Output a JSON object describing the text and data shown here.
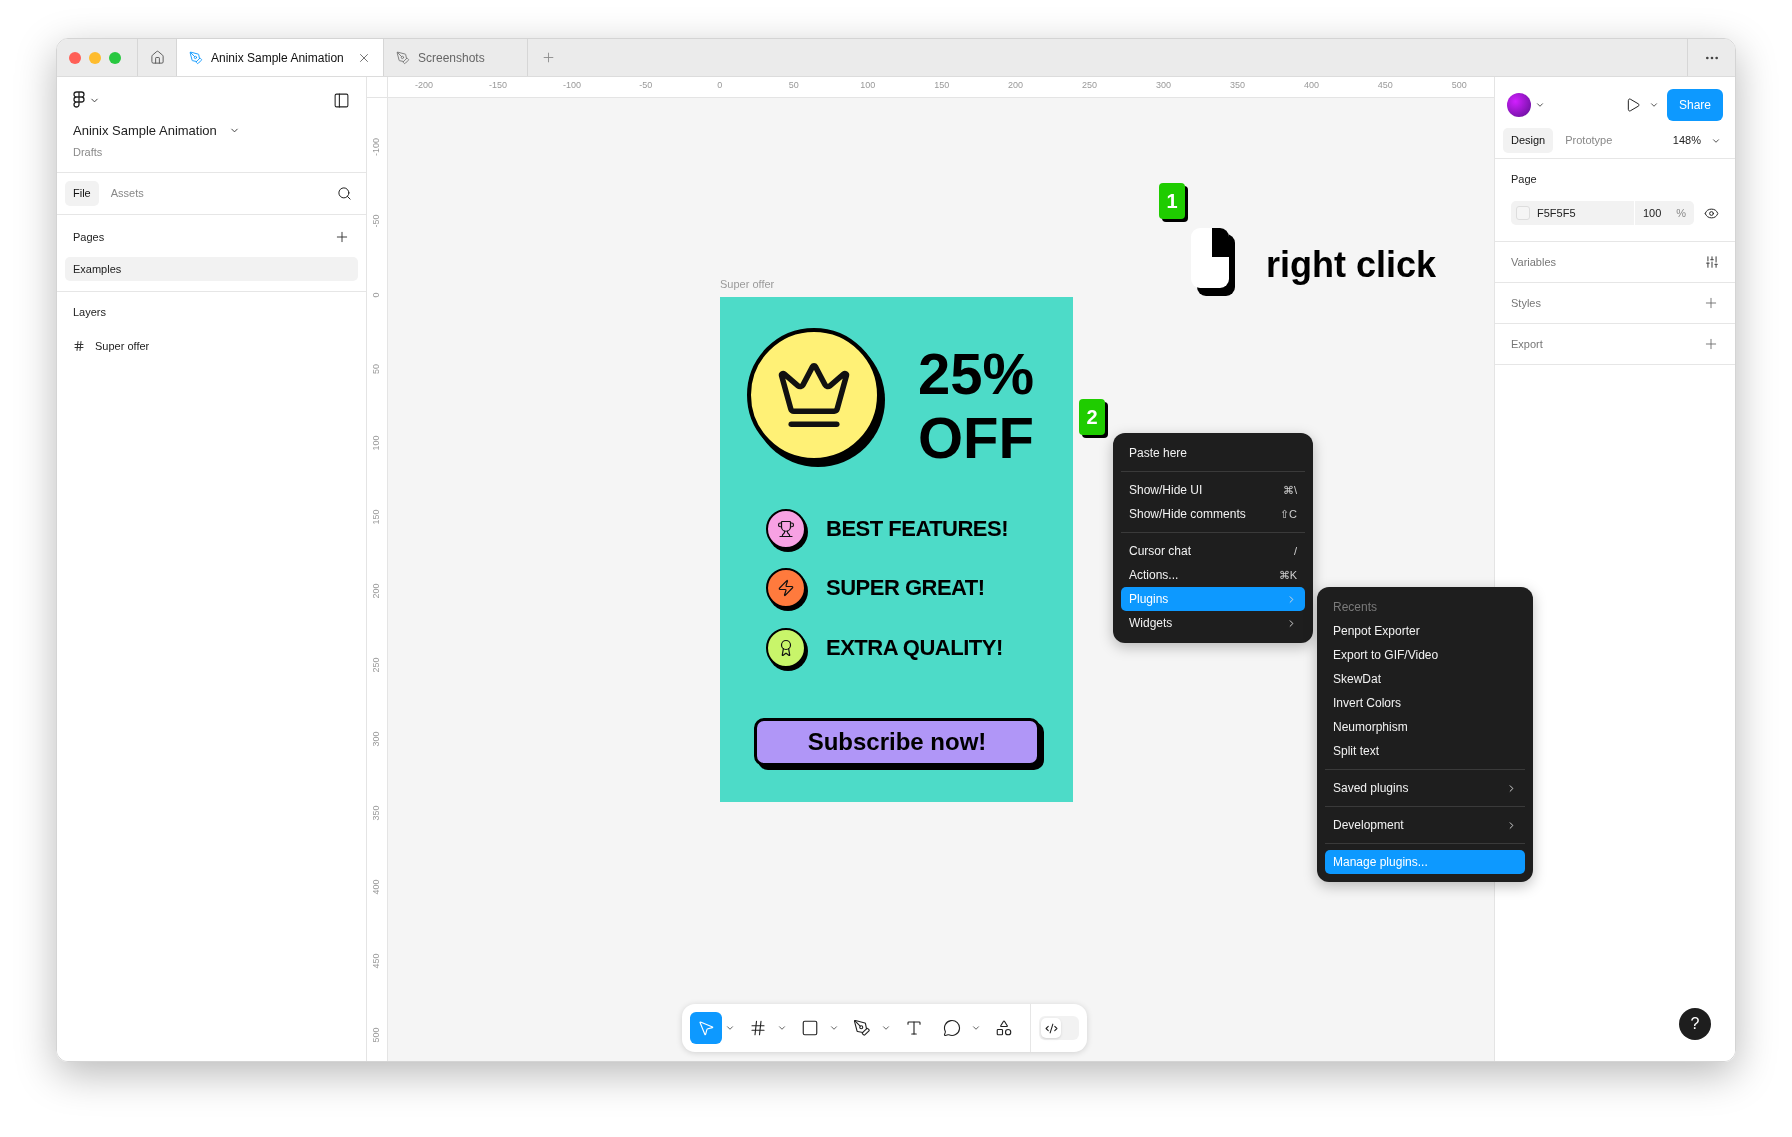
{
  "window": {
    "tabs": [
      {
        "label": "Aninix Sample Animation",
        "selected": true
      },
      {
        "label": "Screenshots",
        "selected": false
      }
    ]
  },
  "sidebar": {
    "file_name": "Aninix Sample Animation",
    "location": "Drafts",
    "tabs": [
      {
        "label": "File",
        "selected": true
      },
      {
        "label": "Assets",
        "selected": false
      }
    ],
    "pages_heading": "Pages",
    "pages": [
      {
        "label": "Examples",
        "selected": true
      }
    ],
    "layers_heading": "Layers",
    "layers": [
      {
        "label": "Super offer"
      }
    ]
  },
  "rulers": {
    "horizontal": [
      "-200",
      "-150",
      "-100",
      "-50",
      "0",
      "50",
      "100",
      "150",
      "200",
      "250",
      "300",
      "350",
      "400",
      "450",
      "500"
    ],
    "vertical": [
      "-100",
      "-50",
      "0",
      "50",
      "100",
      "150",
      "200",
      "250",
      "300",
      "350",
      "400",
      "450",
      "500"
    ]
  },
  "canvas": {
    "frame_label": "Super offer",
    "discount": "25%",
    "discount_word": "OFF",
    "features": [
      {
        "label": "BEST FEATURES!",
        "color": "#f7a1e3",
        "kind": "trophy"
      },
      {
        "label": "SUPER GREAT!",
        "color": "#ff7a3d",
        "kind": "bolt"
      },
      {
        "label": "EXTRA QUALITY!",
        "color": "#c8f56a",
        "kind": "award"
      }
    ],
    "cta": "Subscribe now!",
    "steps": [
      {
        "number": "1"
      },
      {
        "number": "2"
      }
    ],
    "hint": "right click"
  },
  "context_menu": {
    "groups": [
      [
        {
          "label": "Paste here",
          "submenu": false,
          "selected": false
        }
      ],
      [
        {
          "label": "Show/Hide UI",
          "shortcut": "⌘\\",
          "submenu": false,
          "selected": false
        },
        {
          "label": "Show/Hide comments",
          "shortcut": "⇧C",
          "submenu": false,
          "selected": false
        }
      ],
      [
        {
          "label": "Cursor chat",
          "shortcut": "/",
          "submenu": false,
          "selected": false
        },
        {
          "label": "Actions...",
          "shortcut": "⌘K",
          "submenu": false,
          "selected": false
        },
        {
          "label": "Plugins",
          "submenu": true,
          "selected": true
        },
        {
          "label": "Widgets",
          "submenu": true,
          "selected": false
        }
      ]
    ]
  },
  "submenu": {
    "heading": "Recents",
    "groups": [
      [
        {
          "label": "Penpot Exporter",
          "submenu": false,
          "selected": false
        },
        {
          "label": "Export to GIF/Video",
          "submenu": false,
          "selected": false
        },
        {
          "label": "SkewDat",
          "submenu": false,
          "selected": false
        },
        {
          "label": "Invert Colors",
          "submenu": false,
          "selected": false
        },
        {
          "label": "Neumorphism",
          "submenu": false,
          "selected": false
        },
        {
          "label": "Split text",
          "submenu": false,
          "selected": false
        }
      ],
      [
        {
          "label": "Saved plugins",
          "submenu": true,
          "selected": false
        }
      ],
      [
        {
          "label": "Development",
          "submenu": true,
          "selected": false
        }
      ],
      [
        {
          "label": "Manage plugins...",
          "submenu": false,
          "selected": true
        }
      ]
    ]
  },
  "toolbar": {
    "tools": [
      {
        "kind": "move",
        "selected": true,
        "dropdown": true
      },
      {
        "kind": "frame",
        "selected": false,
        "dropdown": true
      },
      {
        "kind": "rectangle",
        "selected": false,
        "dropdown": true
      },
      {
        "kind": "pen",
        "selected": false,
        "dropdown": true
      },
      {
        "kind": "text",
        "selected": false,
        "dropdown": false
      },
      {
        "kind": "comment",
        "selected": false,
        "dropdown": true
      },
      {
        "kind": "components",
        "selected": false,
        "dropdown": false
      }
    ],
    "dev_mode": {
      "on": false
    }
  },
  "right_panel": {
    "share": "Share",
    "tabs": [
      {
        "label": "Design",
        "selected": true
      },
      {
        "label": "Prototype",
        "selected": false
      }
    ],
    "zoom": "148%",
    "page_heading": "Page",
    "page_color": "F5F5F5",
    "page_opacity": "100",
    "opacity_unit": "%",
    "sections": [
      {
        "label": "Variables",
        "kind": "variables"
      },
      {
        "label": "Styles",
        "kind": "add"
      },
      {
        "label": "Export",
        "kind": "add"
      }
    ]
  },
  "help": "?"
}
